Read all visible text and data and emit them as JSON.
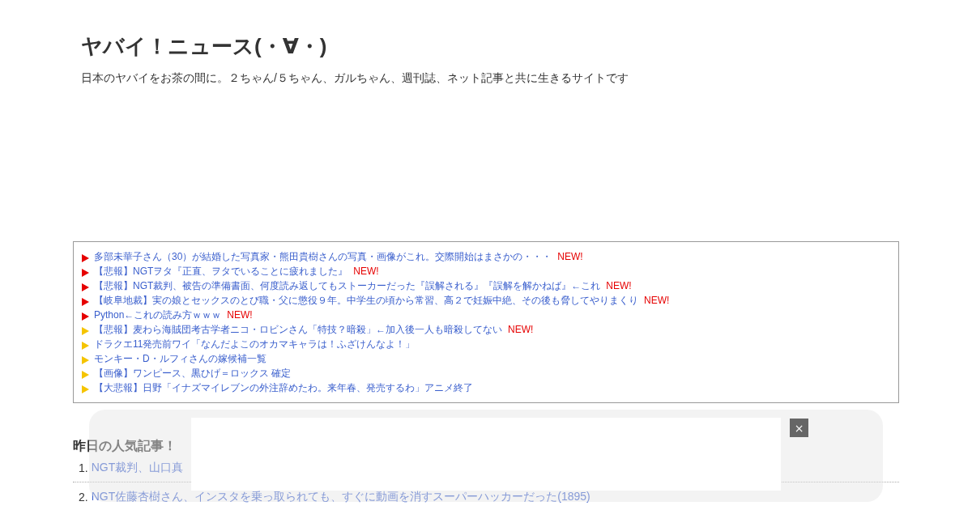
{
  "site": {
    "title": "ヤバイ！ニュース(・∀・)",
    "description": "日本のヤバイをお茶の間に。２ちゃん/５ちゃん、ガルちゃん、週刊誌、ネット記事と共に生きるサイトです"
  },
  "news": [
    {
      "title": "多部未華子さん（30）が結婚した写真家・熊田貴樹さんの写真・画像がこれ。交際開始はまさかの・・・",
      "badge": "NEW!",
      "color": "#e60000"
    },
    {
      "title": "【悲報】NGTヲタ『正直、ヲタでいることに疲れました』",
      "badge": "NEW!",
      "color": "#e60000"
    },
    {
      "title": "【悲報】NGT裁判、被告の準備書面、何度読み返してもストーカーだった『誤解される』『誤解を解かねば』←これ",
      "badge": "NEW!",
      "color": "#e60000"
    },
    {
      "title": "【岐阜地裁】実の娘とセックスのとび職・父に懲役９年。中学生の頃から常習、高２で妊娠中絶、その後も脅してやりまくり",
      "badge": "NEW!",
      "color": "#e60000"
    },
    {
      "title": "Python←これの読み方ｗｗｗ",
      "badge": "NEW!",
      "color": "#e60000"
    },
    {
      "title": "【悲報】麦わら海賊団考古学者ニコ・ロビンさん「特技？暗殺」←加入後一人も暗殺してない",
      "badge": "NEW!",
      "color": "#f5c400"
    },
    {
      "title": "ドラクエ11発売前ワイ「なんだよこのオカマキャラは！ふざけんなよ！」",
      "color": "#f5c400"
    },
    {
      "title": "モンキー・D・ルフィさんの嫁候補一覧",
      "color": "#f5c400"
    },
    {
      "title": "【画像】ワンピース、黒ひげ＝ロックス 確定",
      "color": "#f5c400"
    },
    {
      "title": "【大悲報】日野「イナズマイレブンの外注辞めたわ。来年春、発売するわ」アニメ終了",
      "color": "#f5c400"
    }
  ],
  "popular": {
    "heading": "昨日の人気記事！",
    "items": [
      {
        "number": "1.",
        "title": "NGT裁判、山口真"
      },
      {
        "number": "2.",
        "title": "NGT佐藤杏樹さん、インスタを乗っ取られても、すぐに動画を消すスーパーハッカーだった(1895)"
      }
    ]
  },
  "overlay": {
    "close": "×"
  }
}
